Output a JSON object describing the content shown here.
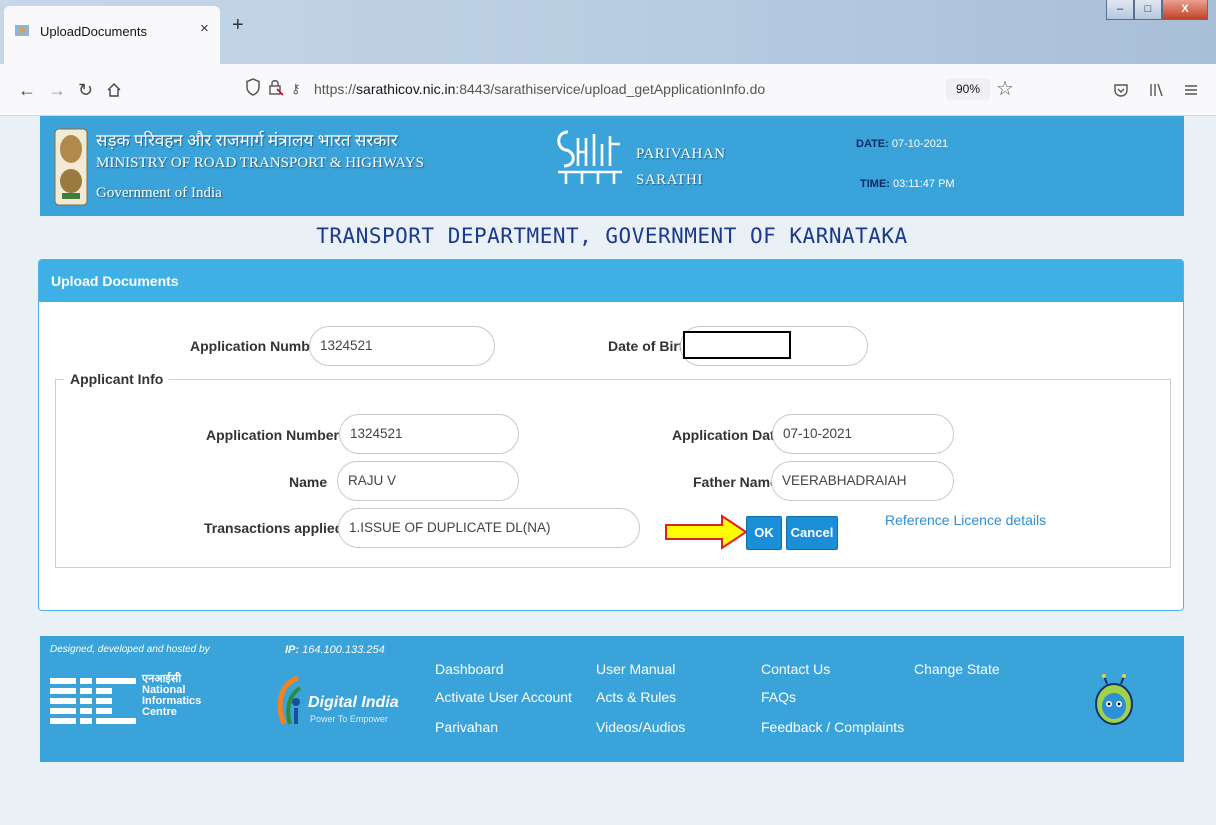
{
  "browser": {
    "tab_title": "UploadDocuments",
    "tab_close": "×",
    "new_tab": "+",
    "url_prefix": "https://",
    "url_domain": "sarathicov.nic.in",
    "url_rest": ":8443/sarathiservice/upload_getApplicationInfo.do",
    "zoom": "90%",
    "window_buttons": [
      "–",
      "□",
      "X"
    ]
  },
  "header": {
    "ministry_hindi": "सड़क परिवहन और राजमार्ग मंत्रालय भारत सरकार",
    "ministry_en": "MINISTRY OF ROAD TRANSPORT & HIGHWAYS",
    "govt": "Government of India",
    "parivahan": "PARIVAHAN",
    "sarathi": "SARATHI",
    "date_label": "DATE:",
    "date_value": "07-10-2021",
    "time_label": "TIME:",
    "time_value": "03:11:47 PM"
  },
  "dept_title": "TRANSPORT DEPARTMENT, GOVERNMENT OF KARNATAKA",
  "panel": {
    "title": "Upload Documents",
    "app_number_label": "Application Number",
    "app_number_value": "1324521",
    "dob_label": "Date of Birth",
    "dob_value": "",
    "legend": "Applicant Info",
    "info": {
      "app_number_label": "Application Number",
      "app_number_value": "1324521",
      "app_date_label": "Application Date",
      "app_date_value": "07-10-2021",
      "name_label": "Name",
      "name_value": "RAJU V",
      "father_label": "Father Name",
      "father_value": "VEERABHADRAIAH",
      "transactions_label": "Transactions applied",
      "transactions_value": "1.ISSUE OF DUPLICATE DL(NA)"
    },
    "ok_label": "OK",
    "cancel_label": "Cancel",
    "reference_link": "Reference Licence details"
  },
  "footer": {
    "designed_by": "Designed, developed and hosted by",
    "ip_label": "IP:",
    "ip_value": "164.100.133.254",
    "nic_hindi": "एनआईसी",
    "nic_en_1": "National",
    "nic_en_2": "Informatics",
    "nic_en_3": "Centre",
    "nic_mark": "NIC",
    "digital_india": "Digital India",
    "digital_india_tag": "Power To Empower",
    "links_col1": [
      "Dashboard",
      "Activate User Account",
      "Parivahan"
    ],
    "links_col2": [
      "User Manual",
      "Acts & Rules",
      "Videos/Audios"
    ],
    "links_col3": [
      "Contact Us",
      "FAQs",
      "Feedback / Complaints"
    ],
    "links_col4": [
      "Change State"
    ]
  },
  "colors": {
    "header_blue": "#3aa3d9",
    "panel_head": "#3fb0e6",
    "button_blue": "#1a8ed6",
    "arrow_fill": "#ffff00",
    "arrow_stroke": "#e02020",
    "title_navy": "#1b3a8c"
  }
}
